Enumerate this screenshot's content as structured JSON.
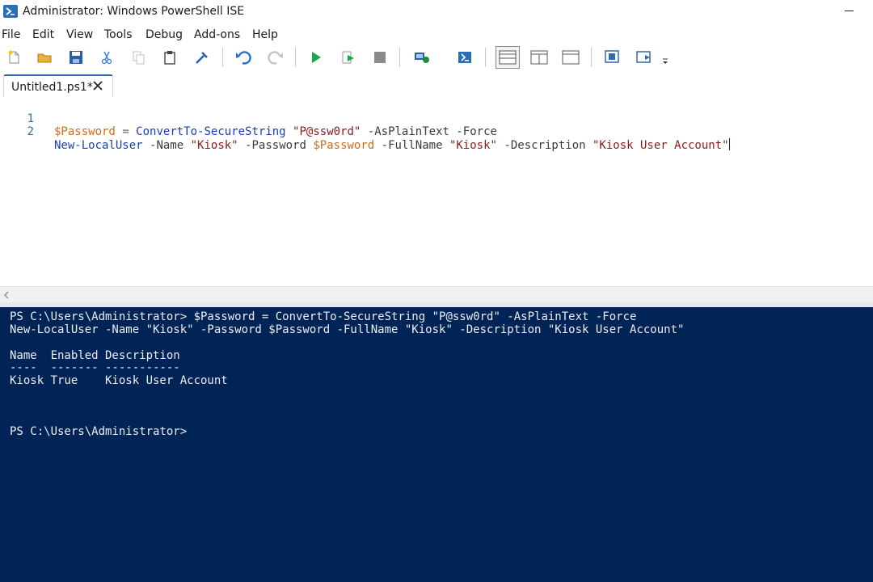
{
  "window": {
    "title": "Administrator: Windows PowerShell ISE"
  },
  "menu": [
    "File",
    "Edit",
    "View",
    "Tools",
    "Debug",
    "Add-ons",
    "Help"
  ],
  "toolbar": {
    "icons": [
      "new-file-icon",
      "open-file-icon",
      "save-icon",
      "cut-icon",
      "copy-icon",
      "paste-icon",
      "clear-icon",
      "undo-icon",
      "redo-icon",
      "run-icon",
      "run-selection-icon",
      "stop-icon",
      "remote-powershell-icon",
      "powershell-icon",
      "layout-top-icon",
      "layout-right-icon",
      "layout-max-icon",
      "show-script-icon",
      "show-commands-icon",
      "more-icon"
    ]
  },
  "tab": {
    "label": "Untitled1.ps1*"
  },
  "editor": {
    "lines": [
      {
        "number": "1",
        "tokens": [
          {
            "text": "$Password",
            "kind": "var"
          },
          {
            "text": " ",
            "kind": "sp"
          },
          {
            "text": "=",
            "kind": "op"
          },
          {
            "text": " ",
            "kind": "sp"
          },
          {
            "text": "ConvertTo-SecureString",
            "kind": "cmd"
          },
          {
            "text": " ",
            "kind": "sp"
          },
          {
            "text": "\"P@ssw0rd\"",
            "kind": "str"
          },
          {
            "text": " ",
            "kind": "sp"
          },
          {
            "text": "-AsPlainText",
            "kind": "par"
          },
          {
            "text": " ",
            "kind": "sp"
          },
          {
            "text": "-Force",
            "kind": "par"
          }
        ]
      },
      {
        "number": "2",
        "tokens": [
          {
            "text": "New-LocalUser",
            "kind": "cmd"
          },
          {
            "text": " ",
            "kind": "sp"
          },
          {
            "text": "-Name",
            "kind": "par"
          },
          {
            "text": " ",
            "kind": "sp"
          },
          {
            "text": "\"Kiosk\"",
            "kind": "str"
          },
          {
            "text": " ",
            "kind": "sp"
          },
          {
            "text": "-Password",
            "kind": "par"
          },
          {
            "text": " ",
            "kind": "sp"
          },
          {
            "text": "$Password",
            "kind": "var"
          },
          {
            "text": " ",
            "kind": "sp"
          },
          {
            "text": "-FullName",
            "kind": "par"
          },
          {
            "text": " ",
            "kind": "sp"
          },
          {
            "text": "\"Kiosk\"",
            "kind": "str"
          },
          {
            "text": " ",
            "kind": "sp"
          },
          {
            "text": "-Description",
            "kind": "par"
          },
          {
            "text": " ",
            "kind": "sp"
          },
          {
            "text": "\"Kiosk User Account\"",
            "kind": "str"
          }
        ]
      }
    ]
  },
  "console": {
    "lines": [
      "PS C:\\Users\\Administrator> $Password = ConvertTo-SecureString \"P@ssw0rd\" -AsPlainText -Force",
      "New-LocalUser -Name \"Kiosk\" -Password $Password -FullName \"Kiosk\" -Description \"Kiosk User Account\"",
      "",
      "Name  Enabled Description",
      "----  ------- -----------",
      "Kiosk True    Kiosk User Account",
      "",
      "",
      "",
      "PS C:\\Users\\Administrator>"
    ]
  },
  "colors": {
    "console_bg": "#012456",
    "console_fg": "#eeedf0",
    "variable": "#d26a1a",
    "command": "#1a3fb5",
    "string": "#8b1a1a",
    "parameter": "#3a3a3a"
  }
}
